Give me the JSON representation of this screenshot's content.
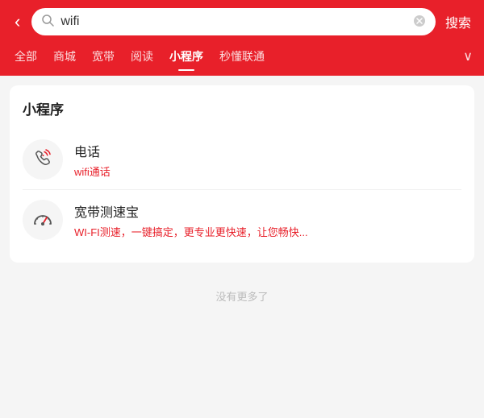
{
  "header": {
    "back_label": "‹",
    "search_value": "wifi",
    "search_placeholder": "搜索",
    "clear_icon": "×",
    "search_btn": "搜索"
  },
  "tabs": [
    {
      "label": "全部",
      "active": false
    },
    {
      "label": "商城",
      "active": false
    },
    {
      "label": "宽带",
      "active": false
    },
    {
      "label": "阅读",
      "active": false
    },
    {
      "label": "小程序",
      "active": true
    },
    {
      "label": "秒懂联通",
      "active": false
    }
  ],
  "tabs_more": "∨",
  "section": {
    "title": "小程序",
    "items": [
      {
        "title": "电话",
        "desc": "wifi通话"
      },
      {
        "title": "宽带测速宝",
        "desc": "WI-FI测速，一键搞定，更专业更快速，让您畅快..."
      }
    ]
  },
  "no_more": "没有更多了"
}
